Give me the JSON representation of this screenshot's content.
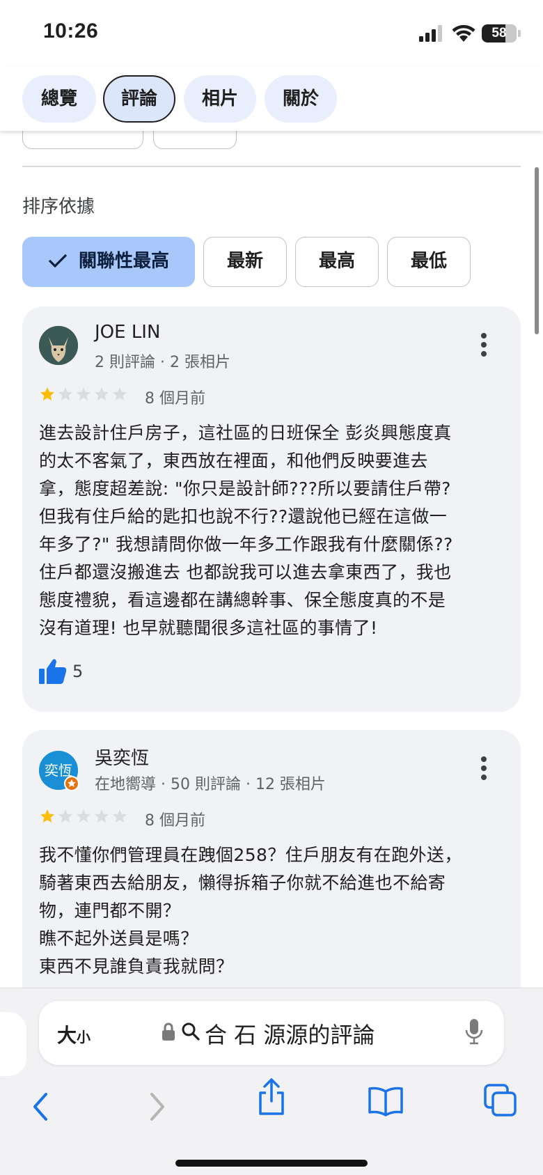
{
  "status": {
    "time": "10:26",
    "battery": "58"
  },
  "tabs": [
    {
      "label": "總覽"
    },
    {
      "label": "評論"
    },
    {
      "label": "相片"
    },
    {
      "label": "關於"
    }
  ],
  "sort": {
    "label": "排序依據",
    "options": [
      {
        "label": "關聯性最高",
        "selected": true
      },
      {
        "label": "最新"
      },
      {
        "label": "最高"
      },
      {
        "label": "最低"
      }
    ]
  },
  "reviews": [
    {
      "author": "JOE LIN",
      "meta": "2 則評論 · 2 張相片",
      "rating": 1,
      "time": "8 個月前",
      "text": "進去設計住戶房子，這社區的日班保全 彭炎興態度真\n的太不客氣了，東西放在裡面，和他們反映要進去\n拿，態度超差說: \"你只是設計師???所以要請住戶帶?\n但我有住戶給的匙扣也說不行??還說他已經在這做一\n年多了?\" 我想請問你做一年多工作跟我有什麼關係??\n住戶都還沒搬進去 也都說我可以進去拿東西了，我也\n態度禮貌，看這邊都在講總幹事、保全態度真的不是\n沒有道理! 也早就聽聞很多這社區的事情了!",
      "likes": "5"
    },
    {
      "author": "吳奕恆",
      "avatar_text": "奕恆",
      "meta": "在地嚮導 · 50 則評論 · 12 張相片",
      "rating": 1,
      "time": "8 個月前",
      "text": "我不懂你們管理員在跩個258？住戶朋友有在跑外送，\n騎著東西去給朋友，懶得拆箱子你就不給進也不給寄\n物，連門都不開？\n瞧不起外送員是嗎？\n東西不見誰負責我就問？"
    }
  ],
  "browser": {
    "size_label": "大",
    "size_small": "小",
    "address": "合 石 源源的評論"
  },
  "colors": {
    "accent": "#1a73e8",
    "star": "#fbbc04",
    "star_empty": "#dadce0",
    "chip_selected": "#a8c7fa",
    "tab_bg": "#e8eefb"
  }
}
